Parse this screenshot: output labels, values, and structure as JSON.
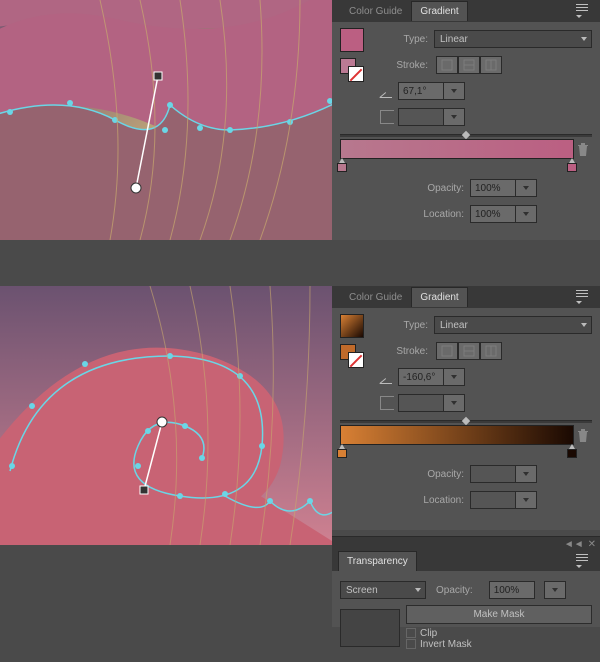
{
  "panels": {
    "gradientTop": {
      "tabs": {
        "colorGuide": "Color Guide",
        "gradient": "Gradient"
      },
      "typeLabel": "Type:",
      "typeValue": "Linear",
      "strokeLabel": "Stroke:",
      "angle": "67,1°",
      "opacityLabel": "Opacity:",
      "opacityValue": "100%",
      "locationLabel": "Location:",
      "locationValue": "100%",
      "swatchBig": "#bb5f82",
      "swatchSmall": "#bb7a94",
      "gradientStops": [
        "#b7788e",
        "#bb5f82"
      ]
    },
    "gradientBot": {
      "tabs": {
        "colorGuide": "Color Guide",
        "gradient": "Gradient"
      },
      "typeLabel": "Type:",
      "typeValue": "Linear",
      "strokeLabel": "Stroke:",
      "angle": "-160,6°",
      "opacityLabel": "Opacity:",
      "opacityValue": "",
      "locationLabel": "Location:",
      "locationValue": "",
      "swatchBigGradient": [
        "#d88034",
        "#1a0902"
      ],
      "swatchSmall": "#c06a2a",
      "gradientStops": [
        "#d88034",
        "#1a0902"
      ]
    },
    "transparency": {
      "tab": "Transparency",
      "mode": "Screen",
      "opacityLabel": "Opacity:",
      "opacityValue": "100%",
      "makeMask": "Make Mask",
      "clip": "Clip",
      "invertMask": "Invert Mask"
    }
  },
  "iconNames": {
    "menu": "panel-menu-icon",
    "trash": "trash-icon",
    "strokeWithin": "stroke-within-icon",
    "strokeAlong": "stroke-along-icon",
    "strokeAcross": "stroke-across-icon",
    "angle": "angle-icon",
    "aspect": "aspect-lock-icon",
    "reverse": "reverse-gradient-icon",
    "swatchFill": "fill-swatch",
    "swatchNone": "none-swatch",
    "minimize": "minimize-icon",
    "close": "close-icon"
  }
}
